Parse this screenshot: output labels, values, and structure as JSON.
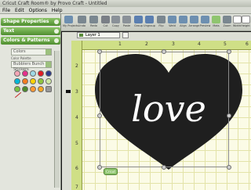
{
  "window": {
    "title": "Cricut Craft Room® by Provo Craft - Untitled"
  },
  "menu": [
    "File",
    "Edit",
    "Options",
    "Help"
  ],
  "toolbar": [
    {
      "label": "My Projects",
      "icon": "folder-icon",
      "color": "#6d8fb0"
    },
    {
      "label": "Undo",
      "icon": "undo-icon",
      "color": "#7a8790"
    },
    {
      "label": "Redo",
      "icon": "redo-icon",
      "color": "#7a8790"
    },
    {
      "label": "Cut",
      "icon": "scissors-icon",
      "color": "#7a7f86"
    },
    {
      "label": "Copy",
      "icon": "copy-icon",
      "color": "#8a9198"
    },
    {
      "label": "Paste",
      "icon": "paste-icon",
      "color": "#8a9198"
    },
    {
      "label": "Group",
      "icon": "group-icon",
      "color": "#5b7fb0"
    },
    {
      "label": "Ungroup",
      "icon": "ungroup-icon",
      "color": "#5b7fb0"
    },
    {
      "label": "Flip",
      "icon": "flip-icon",
      "color": "#7a8790"
    },
    {
      "label": "Weld",
      "icon": "weld-icon",
      "color": "#6d8fb0"
    },
    {
      "label": "Align",
      "icon": "align-icon",
      "color": "#6d8fb0"
    },
    {
      "label": "Arrange",
      "icon": "arrange-icon",
      "color": "#6d8fb0"
    },
    {
      "label": "Preview",
      "icon": "preview-icon",
      "color": "#6d8fb0"
    },
    {
      "label": "Mats",
      "icon": "mat-icon",
      "color": "#8fc56f"
    },
    {
      "label": "Zoom",
      "icon": "zoom-icon",
      "color": "#7a8790"
    },
    {
      "label": "Width",
      "icon": "width-icon",
      "color": "#ffffff"
    },
    {
      "label": "Height",
      "icon": "height-icon",
      "color": "#ffffff"
    }
  ],
  "panel": {
    "sections": [
      {
        "label": "Shape Properties"
      },
      {
        "label": "Text"
      },
      {
        "label": "Colors & Patterns"
      }
    ],
    "mode_select": "Colors",
    "palette_select": "Bubblers Bunch Stickers",
    "palette": [
      "#f4a6b5",
      "#e7308b",
      "#9ed9e6",
      "#e31b23",
      "#2c3a8c",
      "#00b7d9",
      "#f47b20",
      "#ffd200",
      "#8fc640",
      "#cfe8a3",
      "#7bc142",
      "#4c8a2b",
      "#ff9933",
      "#f6a623",
      "#7a5c9e",
      "#999999"
    ]
  },
  "canvas": {
    "tab_label": "Layer 1",
    "ruler_top": [
      "1",
      "2",
      "3",
      "4",
      "5",
      "6"
    ],
    "ruler_left": [
      "2",
      "3",
      "4",
      "5",
      "6",
      "7"
    ],
    "shape_text": "love",
    "mat_badge": "Cricut"
  },
  "colors": {
    "accent_green": "#6ea84a",
    "heart_fill": "#1f1f1f",
    "mat_bg": "#fbfbe6",
    "ruler": "#cfdf86"
  }
}
